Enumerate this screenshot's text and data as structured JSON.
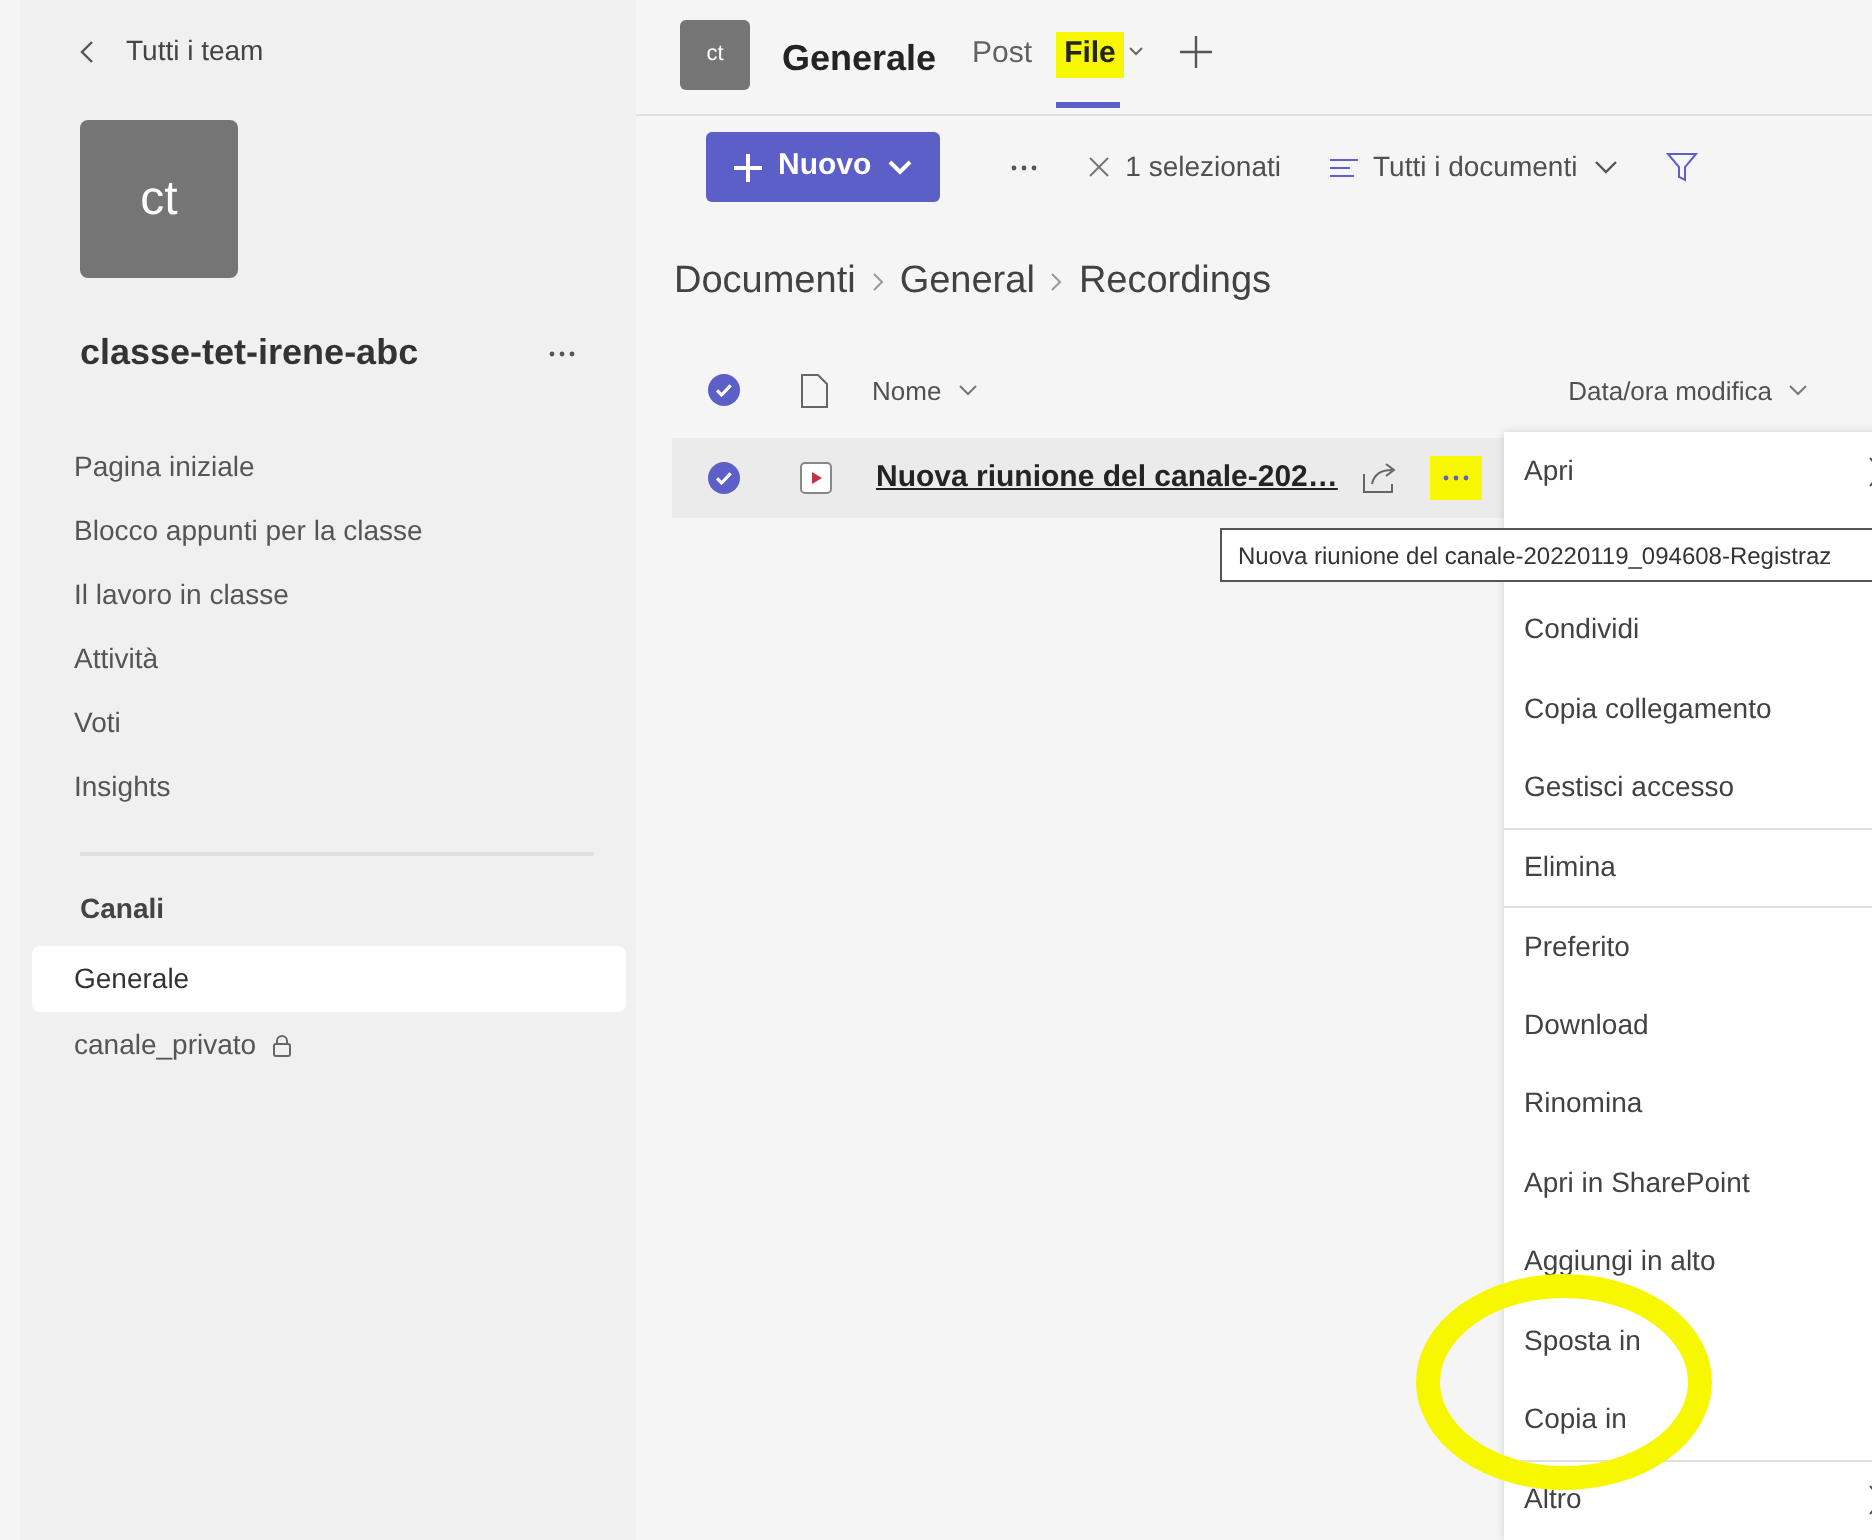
{
  "sidebar": {
    "back_link": "Tutti i team",
    "team_avatar": "ct",
    "team_name": "classe-tet-irene-abc",
    "items": [
      "Pagina iniziale",
      "Blocco appunti per la classe",
      "Il lavoro in classe",
      "Attività",
      "Voti",
      "Insights"
    ],
    "channels_heading": "Canali",
    "channels": [
      {
        "label": "Generale",
        "selected": true,
        "locked": false
      },
      {
        "label": "canale_privato",
        "selected": false,
        "locked": true
      }
    ]
  },
  "header": {
    "avatar": "ct",
    "title": "Generale",
    "tabs": [
      {
        "label": "Post",
        "selected": false,
        "dropdown": false,
        "highlighted": false
      },
      {
        "label": "File",
        "selected": true,
        "dropdown": true,
        "highlighted": true
      }
    ]
  },
  "toolbar": {
    "new_button": "Nuovo",
    "selection": "1 selezionati",
    "view": "Tutti i documenti"
  },
  "breadcrumb": [
    "Documenti",
    "General",
    "Recordings"
  ],
  "columns": [
    "Nome",
    "Data/ora modifica"
  ],
  "header_checked": true,
  "rows": [
    {
      "name": "Nuova riunione del canale-202…",
      "selected": true,
      "more_highlighted": true
    }
  ],
  "tooltip": "Nuova riunione del canale-20220119_094608-Registraz",
  "context_menu": [
    {
      "label": "Apri",
      "submenu": true,
      "divider_before": false,
      "circled": false
    },
    {
      "label": "Condividi",
      "submenu": false,
      "divider_before": false,
      "circled": false,
      "gap_before": true
    },
    {
      "label": "Copia collegamento",
      "submenu": false,
      "divider_before": false,
      "circled": false
    },
    {
      "label": "Gestisci accesso",
      "submenu": false,
      "divider_before": false,
      "circled": false
    },
    {
      "label": "Elimina",
      "submenu": false,
      "divider_before": true,
      "circled": false
    },
    {
      "label": "Preferito",
      "submenu": false,
      "divider_before": true,
      "circled": false
    },
    {
      "label": "Download",
      "submenu": false,
      "divider_before": false,
      "circled": false
    },
    {
      "label": "Rinomina",
      "submenu": false,
      "divider_before": false,
      "circled": false
    },
    {
      "label": "Apri in SharePoint",
      "submenu": false,
      "divider_before": false,
      "circled": false
    },
    {
      "label": "Aggiungi in alto",
      "submenu": false,
      "divider_before": false,
      "circled": false
    },
    {
      "label": "Sposta in",
      "submenu": false,
      "divider_before": false,
      "circled": true
    },
    {
      "label": "Copia in",
      "submenu": false,
      "divider_before": false,
      "circled": true
    },
    {
      "label": "Altro",
      "submenu": true,
      "divider_before": true,
      "circled": false
    }
  ]
}
